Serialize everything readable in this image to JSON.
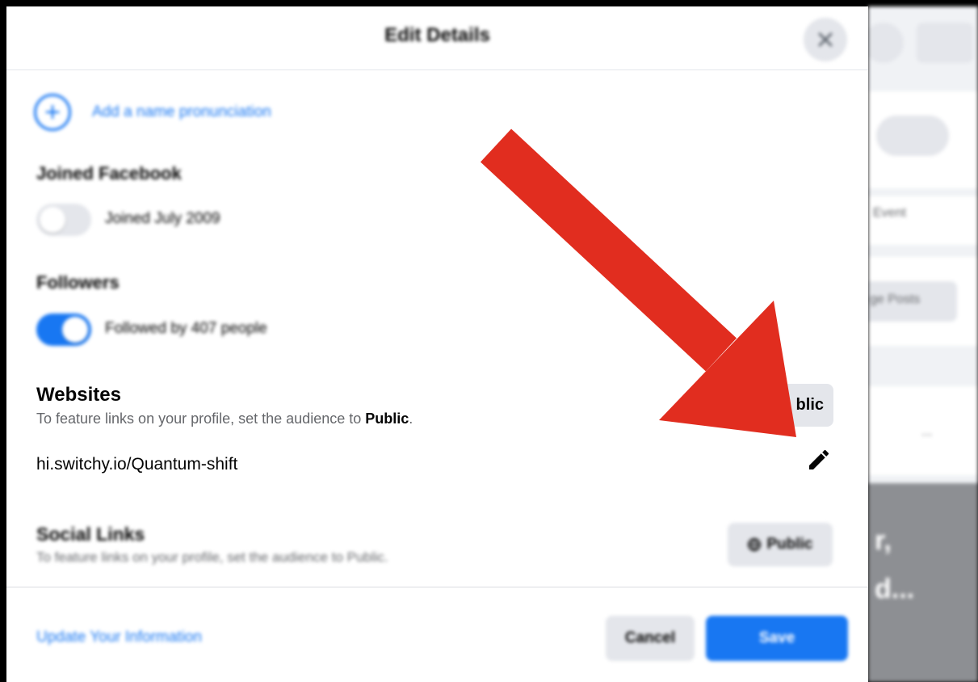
{
  "dialog": {
    "title": "Edit Details",
    "close_icon": "close-icon"
  },
  "pronunciation": {
    "label": "Add a name pronunciation",
    "icon": "plus-circle-icon"
  },
  "joined": {
    "title": "Joined Facebook",
    "label": "Joined July 2009",
    "toggle_on": false
  },
  "followers": {
    "title": "Followers",
    "label": "Followed by 407 people",
    "toggle_on": true
  },
  "websites": {
    "title": "Websites",
    "subtitle_prefix": "To feature links on your profile, set the audience to ",
    "subtitle_bold": "Public",
    "subtitle_suffix": ".",
    "audience_button": "blic",
    "link": "hi.switchy.io/Quantum-shift",
    "edit_icon": "pencil-icon"
  },
  "social_links": {
    "title": "Social Links",
    "subtitle": "To feature links on your profile, set the audience to Public.",
    "audience_button": "Public",
    "audience_icon": "globe-icon"
  },
  "footer": {
    "update_link": "Update Your Information",
    "cancel": "Cancel",
    "save": "Save"
  },
  "background": {
    "text_1": "Event",
    "text_2": "ge Posts",
    "ellipsis": "...",
    "big_text_1": "r,",
    "big_text_2": "d..."
  },
  "annotation": {
    "arrow_color": "#e12d1f",
    "icon": "red-arrow-icon"
  },
  "colors": {
    "accent": "#1877f2",
    "button_gray": "#e4e6eb",
    "text_secondary": "#65676b"
  }
}
